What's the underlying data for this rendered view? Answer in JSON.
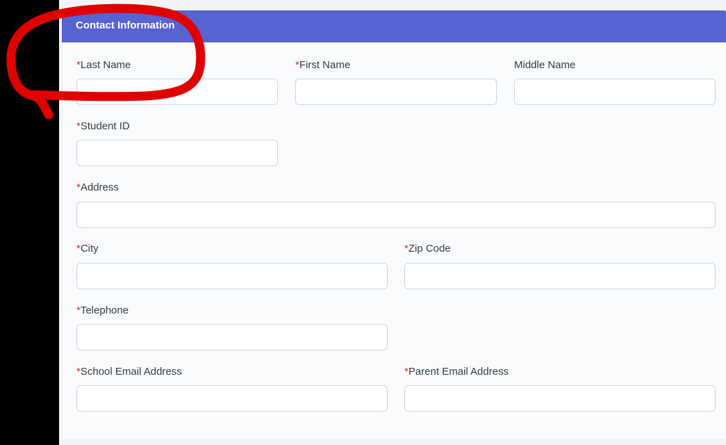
{
  "form": {
    "section_title": "Contact Information",
    "required_marker": "*",
    "fields": {
      "last_name": {
        "label": "Last Name",
        "value": "",
        "required": true
      },
      "first_name": {
        "label": "First Name",
        "value": "",
        "required": true
      },
      "middle_name": {
        "label": "Middle Name",
        "value": "",
        "required": false
      },
      "student_id": {
        "label": "Student ID",
        "value": "",
        "required": true
      },
      "address": {
        "label": "Address",
        "value": "",
        "required": true
      },
      "city": {
        "label": "City",
        "value": "",
        "required": true
      },
      "zip_code": {
        "label": "Zip Code",
        "value": "",
        "required": true
      },
      "telephone": {
        "label": "Telephone",
        "value": "",
        "required": true
      },
      "school_email": {
        "label": "School Email Address",
        "value": "",
        "required": true
      },
      "parent_email": {
        "label": "Parent Email Address",
        "value": "",
        "required": true
      }
    }
  },
  "colors": {
    "header": "#5763d1",
    "required_marker": "#d62b2b",
    "annotation_stroke": "#e00000"
  }
}
